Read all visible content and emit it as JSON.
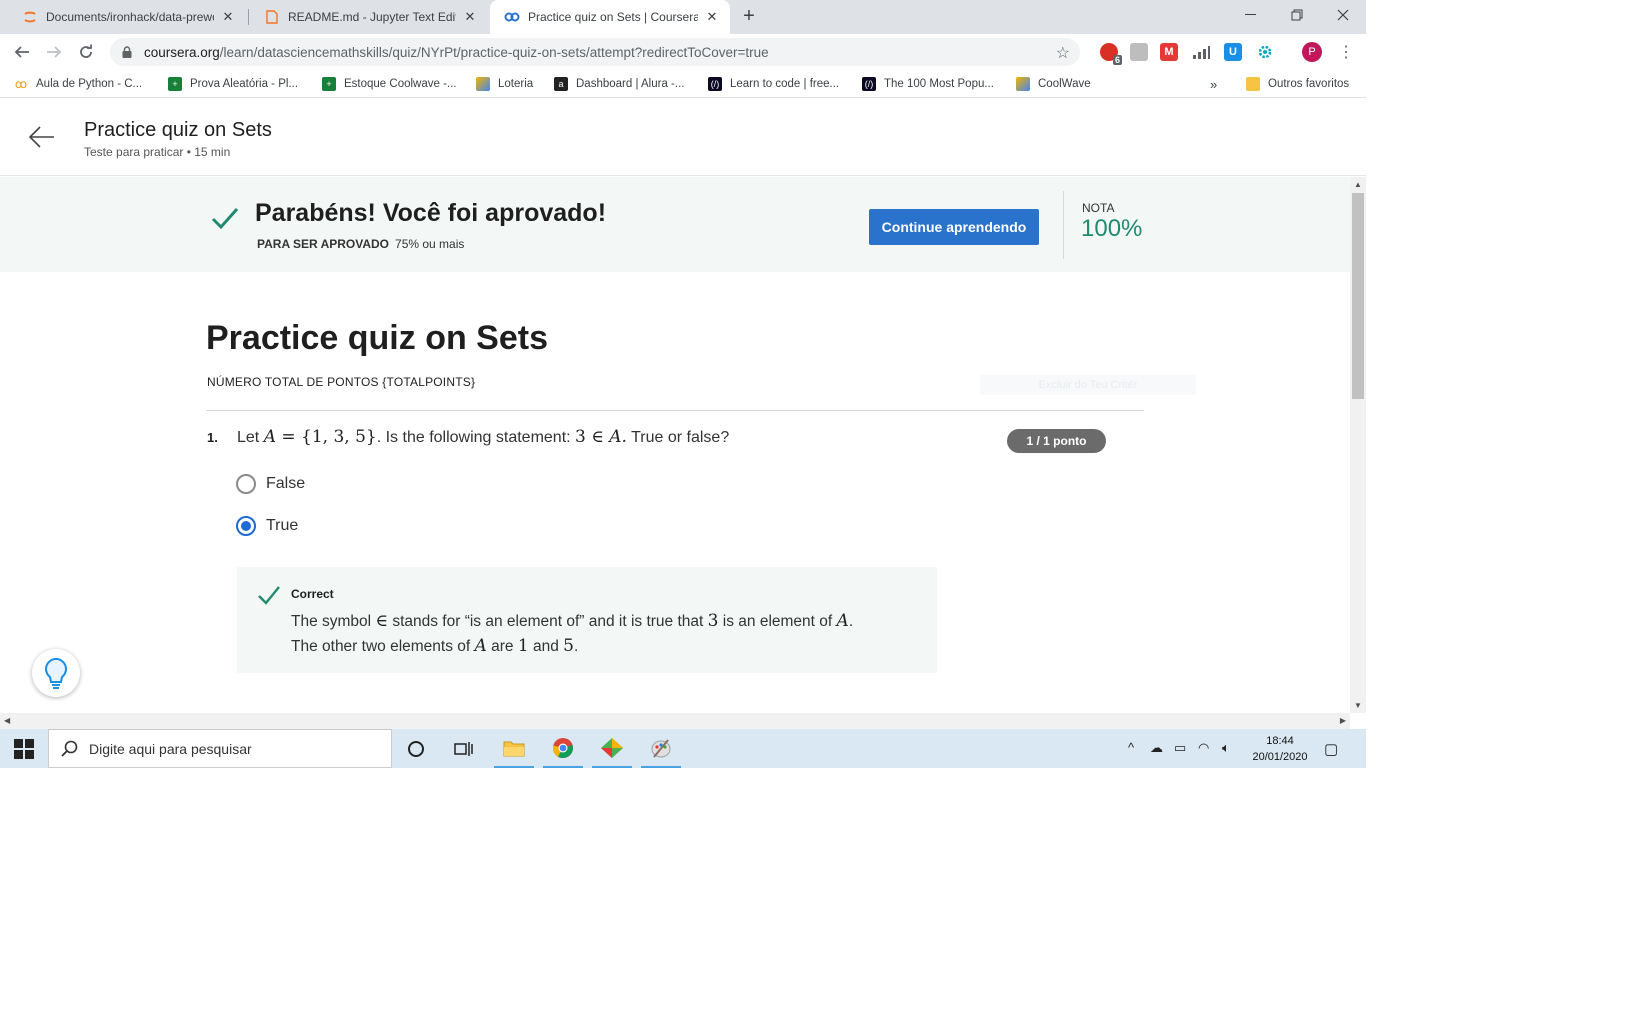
{
  "browser": {
    "tabs": [
      {
        "title": "Documents/ironhack/data-prewo",
        "icon": "jupyter-icon"
      },
      {
        "title": "README.md - Jupyter Text Editor",
        "icon": "file-icon"
      },
      {
        "title": "Practice quiz on Sets | Coursera",
        "icon": "coursera-icon",
        "active": true
      }
    ],
    "url_host": "coursera.org",
    "url_path": "/learn/datasciencemathskills/quiz/NYrPt/practice-quiz-on-sets/attempt?redirectToCover=true",
    "extension_badge": "6",
    "profile_initial": "P",
    "bookmarks": [
      "Aula de Python - C...",
      "Prova Aleatória - Pl...",
      "Estoque Coolwave -...",
      "Loteria",
      "Dashboard | Alura -...",
      "Learn to code | free...",
      "The 100 Most Popu...",
      "CoolWave"
    ],
    "bookmarks_more": "»",
    "other_favorites": "Outros favoritos"
  },
  "header": {
    "title": "Practice quiz on Sets",
    "subtitle": "Teste para praticar • 15 min"
  },
  "banner": {
    "headline": "Parabéns! Você foi aprovado!",
    "pass_label": "PARA SER APROVADO",
    "pass_value": "75% ou mais",
    "continue_label": "Continue aprendendo",
    "grade_label": "NOTA",
    "grade_value": "100%"
  },
  "quiz": {
    "title": "Practice quiz on Sets",
    "total_points": "NÚMERO TOTAL DE PONTOS {TOTALPOINTS}",
    "ghost_label": "Excluir do Teu Critér",
    "question": {
      "number": "1.",
      "text_1": "Let ",
      "var_a": "A",
      "set_expr": " = {1, 3, 5}",
      "text_2": ". Is the following statement: ",
      "statement_num": "3 ∈ ",
      "statement_var": "A.",
      "text_3": " True or false?",
      "points": "1 / 1 ponto",
      "options": [
        {
          "label": "False",
          "selected": false
        },
        {
          "label": "True",
          "selected": true
        }
      ]
    },
    "feedback": {
      "label": "Correct",
      "t1": "The symbol ",
      "sym": "∈",
      "t2": " stands for “is an element of” and it is true that ",
      "n3": "3",
      "t3": " is an element of ",
      "a1": "A",
      "t4": ".",
      "t5": "The other two elements of ",
      "a2": "A",
      "t6": " are ",
      "n1": "1",
      "t7": " and ",
      "n5": "5",
      "t8": "."
    }
  },
  "taskbar": {
    "search_placeholder": "Digite aqui para pesquisar",
    "time": "18:44",
    "date": "20/01/2020"
  },
  "colors": {
    "accent_blue": "#2a73cc",
    "success_green": "#1f8a70",
    "banner_bg": "#f3f8f6"
  }
}
